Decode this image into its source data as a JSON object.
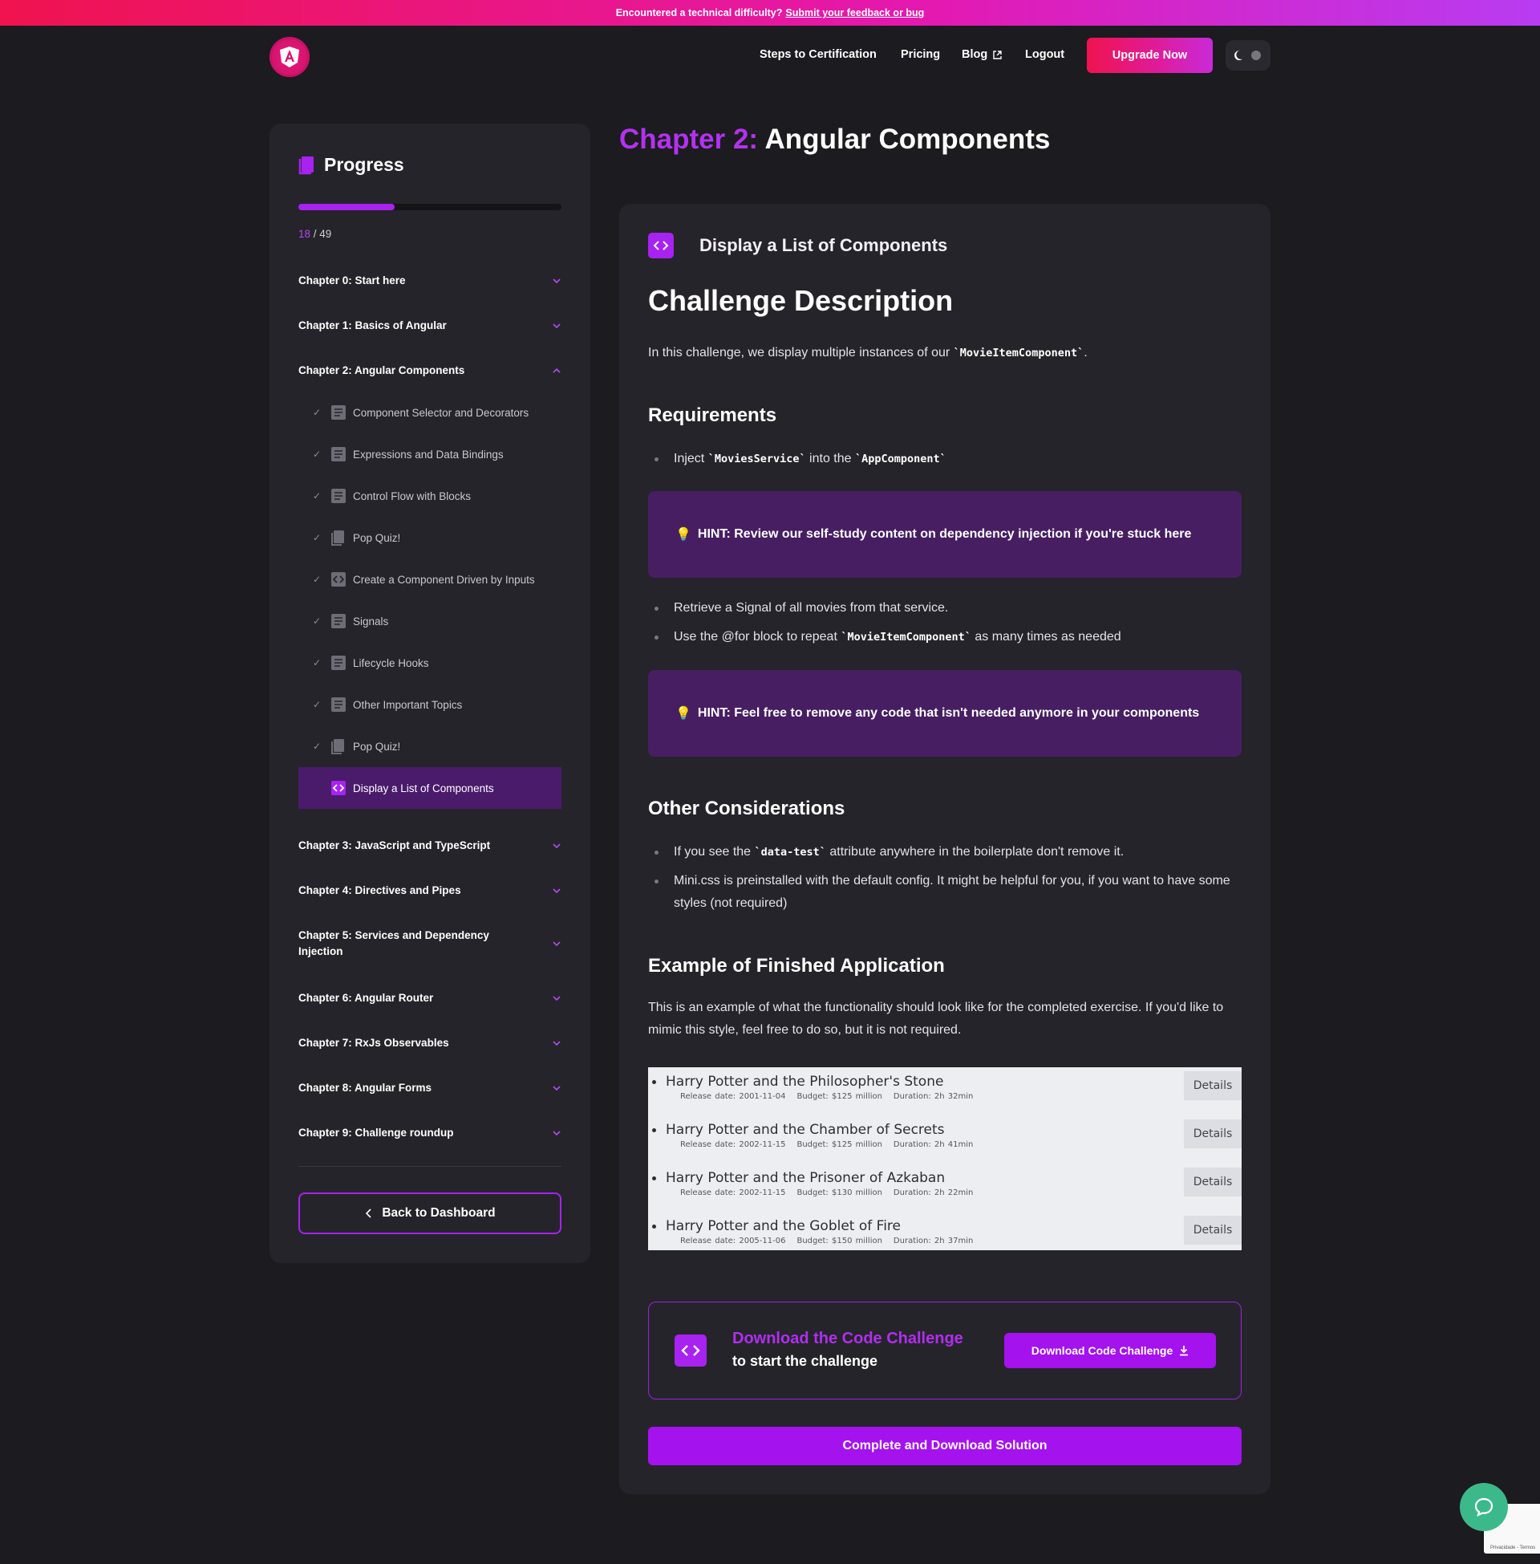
{
  "banner": {
    "text": "Encountered a technical difficulty?",
    "link": "Submit your feedback or bug"
  },
  "header": {
    "nav": [
      "Steps to Certification",
      "Pricing",
      "Blog",
      "Logout"
    ],
    "upgrade": "Upgrade Now"
  },
  "sidebar": {
    "title": "Progress",
    "progress": {
      "current": "18",
      "separator": " / ",
      "total": "49",
      "fraction": 0.367
    },
    "chapters": [
      "Chapter 0: Start here",
      "Chapter 1: Basics of Angular",
      "Chapter 2: Angular Components",
      "Chapter 3: JavaScript and TypeScript",
      "Chapter 4: Directives and Pipes",
      "Chapter 5: Services and Dependency Injection",
      "Chapter 6: Angular Router",
      "Chapter 7: RxJs Observables",
      "Chapter 8: Angular Forms",
      "Chapter 9: Challenge roundup"
    ],
    "lessons": [
      "Component Selector and Decorators",
      "Expressions and Data Bindings",
      "Control Flow with Blocks",
      "Pop Quiz!",
      "Create a Component Driven by Inputs",
      "Signals",
      "Lifecycle Hooks",
      "Other Important Topics",
      "Pop Quiz!",
      "Display a List of Components"
    ],
    "back": "Back to Dashboard"
  },
  "main": {
    "title_prefix": "Chapter 2:",
    "title": "Angular Components",
    "lesson_title": "Display a List of Components",
    "h1": "Challenge Description",
    "intro": {
      "pre": "In this challenge, we display multiple instances of our ",
      "code": "`MovieItemComponent`",
      "post": "."
    },
    "requirements_title": "Requirements",
    "req1": {
      "pre": "Inject ",
      "code1": "`MoviesService`",
      "mid": " into the ",
      "code2": "`AppComponent`"
    },
    "hint1": "HINT: Review our self-study content on dependency injection if you're stuck here",
    "req2": "Retrieve a Signal of all movies from that service.",
    "req3": {
      "pre": "Use the @for block to repeat ",
      "code": "`MovieItemComponent`",
      "post": " as many times as needed"
    },
    "hint2": "HINT: Feel free to remove any code that isn't needed anymore in your components",
    "other_title": "Other Considerations",
    "other1": {
      "pre": "If you see the ",
      "code": "`data-test`",
      "post": " attribute anywhere in the boilerplate don't remove it."
    },
    "other2": "Mini.css is preinstalled with the default config. It might be helpful for you, if you want to have some styles (not required)",
    "example_title": "Example of Finished Application",
    "example_desc": "This is an example of what the functionality should look like for the completed exercise. If you'd like to mimic this style, feel free to do so, but it is not required.",
    "movies": [
      {
        "title": "Harry Potter and the Philosopher's Stone",
        "release": "Release date: 2001-11-04",
        "budget": "Budget: $125 million",
        "duration": "Duration: 2h 32min",
        "details": "Details"
      },
      {
        "title": "Harry Potter and the Chamber of Secrets",
        "release": "Release date: 2002-11-15",
        "budget": "Budget: $125 million",
        "duration": "Duration: 2h 41min",
        "details": "Details"
      },
      {
        "title": "Harry Potter and the Prisoner of Azkaban",
        "release": "Release date: 2002-11-15",
        "budget": "Budget: $130 million",
        "duration": "Duration: 2h 22min",
        "details": "Details"
      },
      {
        "title": "Harry Potter and the Goblet of Fire",
        "release": "Release date: 2005-11-06",
        "budget": "Budget: $150 million",
        "duration": "Duration: 2h 37min",
        "details": "Details"
      }
    ],
    "download": {
      "title": "Download the Code Challenge",
      "subtitle": "to start the challenge",
      "button": "Download Code Challenge"
    },
    "solution": "Complete and Download Solution"
  },
  "recaptcha": "Privacidade - Termos",
  "colors": {
    "accent": "#a822f0",
    "brand_red": "#f0134f",
    "hint_bg": "#471e62",
    "chat": "#3bb98b"
  }
}
